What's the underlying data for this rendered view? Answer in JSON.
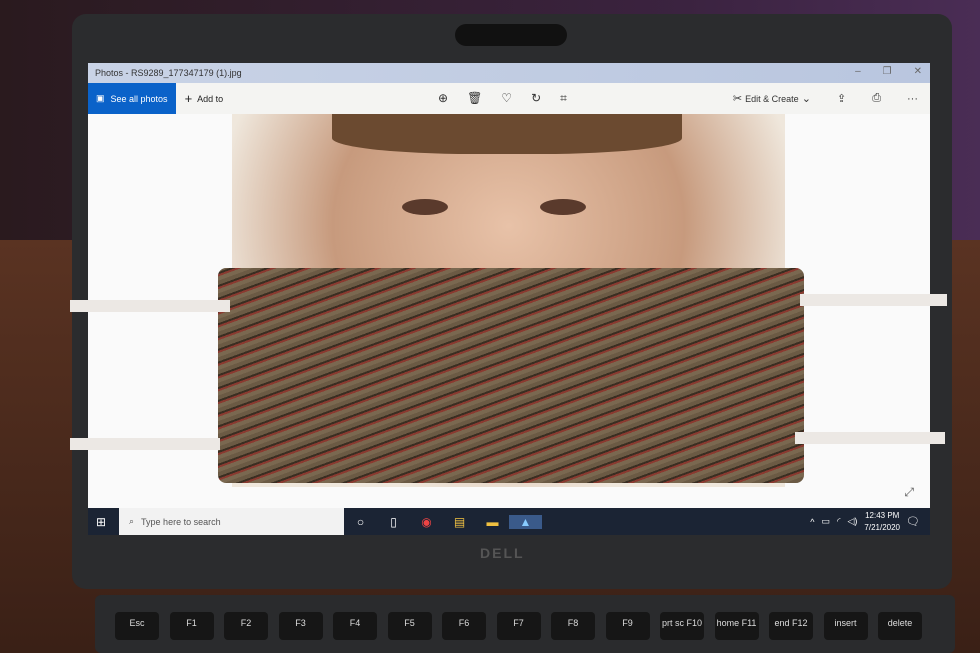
{
  "window": {
    "title": "Photos - RS9289_177347179 (1).jpg",
    "minimize": "–",
    "maximize": "❐",
    "close": "✕"
  },
  "toolbar": {
    "see_all_photos": "See all photos",
    "add_to": "Add to",
    "edit_create": "Edit & Create",
    "more": "···"
  },
  "taskbar": {
    "search_placeholder": "Type here to search",
    "time": "12:43 PM",
    "date": "7/21/2020"
  },
  "laptop": {
    "brand": "DELL"
  },
  "keyboard": {
    "keys": [
      "Esc",
      "F1",
      "F2",
      "F3",
      "F4",
      "F5",
      "F6",
      "F7",
      "F8",
      "F9",
      "prt sc F10",
      "home F11",
      "end F12",
      "insert",
      "delete"
    ]
  },
  "colors": {
    "accent": "#0a62c9",
    "taskbar": "#1b2434"
  }
}
